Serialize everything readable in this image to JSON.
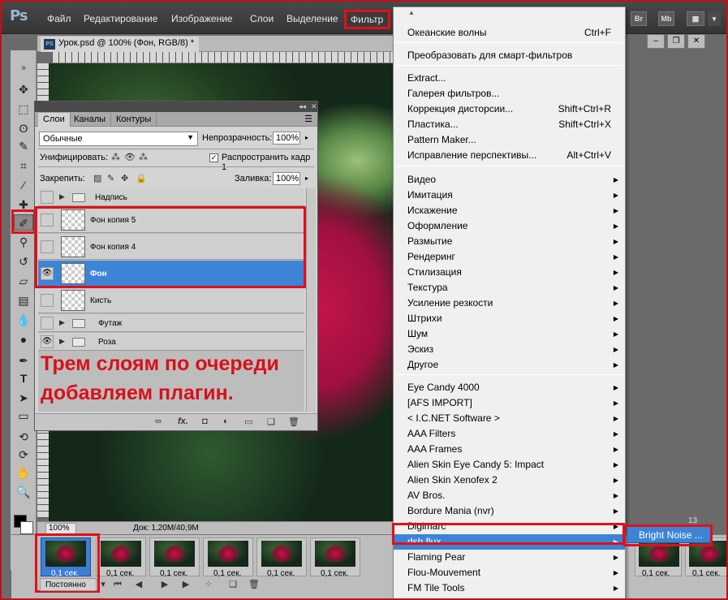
{
  "app": {
    "logo": "Ps",
    "menu": [
      "Файл",
      "Редактирование",
      "Изображение",
      "Слои",
      "Выделение",
      "Фильтр"
    ],
    "menubar_buttons": [
      "Br",
      "Mb"
    ]
  },
  "document": {
    "tab_title": "Урок.psd @ 100% (Фон, RGB/8) *",
    "ps_icon": "PS",
    "zoom": "100%",
    "doc_info": "Док: 1,20M/40,9M",
    "timeline_marker": "13"
  },
  "layers_panel": {
    "tabs": [
      "Слои",
      "Каналы",
      "Контуры"
    ],
    "blend_mode": "Обычные",
    "opacity_label": "Непрозрачность:",
    "opacity_value": "100%",
    "unify_label": "Унифицировать:",
    "propagate_label": "Распространить кадр 1",
    "lock_label": "Закрепить:",
    "fill_label": "Заливка:",
    "fill_value": "100%",
    "layers": [
      {
        "name": "Надпись",
        "type": "group",
        "visible": false
      },
      {
        "name": "Фон копия 5",
        "type": "layer",
        "visible": false
      },
      {
        "name": "Фон копия 4",
        "type": "layer",
        "visible": false
      },
      {
        "name": "Фон",
        "type": "layer",
        "visible": true,
        "selected": true
      },
      {
        "name": "Кисть",
        "type": "layer",
        "visible": false
      },
      {
        "name": "Футаж",
        "type": "group",
        "visible": false
      },
      {
        "name": "Роза",
        "type": "group",
        "visible": true
      }
    ],
    "bottom_icons": [
      "link-icon",
      "fx-icon",
      "mask-icon",
      "adjustment-icon",
      "new-group-icon",
      "new-layer-icon",
      "trash-icon"
    ],
    "fx_label": "fx."
  },
  "annotation": "Трем слоям по очереди добавляем плагин.",
  "filter_menu": {
    "groups": [
      [
        {
          "label": "Океанские волны",
          "shortcut": "Ctrl+F"
        }
      ],
      [
        {
          "label": "Преобразовать для смарт-фильтров"
        }
      ],
      [
        {
          "label": "Extract..."
        },
        {
          "label": "Галерея фильтров..."
        },
        {
          "label": "Коррекция дисторсии...",
          "shortcut": "Shift+Ctrl+R"
        },
        {
          "label": "Пластика...",
          "shortcut": "Shift+Ctrl+X"
        },
        {
          "label": "Pattern Maker..."
        },
        {
          "label": "Исправление перспективы...",
          "shortcut": "Alt+Ctrl+V"
        }
      ],
      [
        {
          "label": "Видео",
          "sub": true
        },
        {
          "label": "Имитация",
          "sub": true
        },
        {
          "label": "Искажение",
          "sub": true
        },
        {
          "label": "Оформление",
          "sub": true
        },
        {
          "label": "Размытие",
          "sub": true
        },
        {
          "label": "Рендеринг",
          "sub": true
        },
        {
          "label": "Стилизация",
          "sub": true
        },
        {
          "label": "Текстура",
          "sub": true
        },
        {
          "label": "Усиление резкости",
          "sub": true
        },
        {
          "label": "Штрихи",
          "sub": true
        },
        {
          "label": "Шум",
          "sub": true
        },
        {
          "label": "Эскиз",
          "sub": true
        },
        {
          "label": "Другое",
          "sub": true
        }
      ],
      [
        {
          "label": "Eye Candy 4000",
          "sub": true
        },
        {
          "label": "[AFS IMPORT]",
          "sub": true
        },
        {
          "label": "< I.C.NET Software >",
          "sub": true
        },
        {
          "label": "AAA Filters",
          "sub": true
        },
        {
          "label": "AAA Frames",
          "sub": true
        },
        {
          "label": "Alien Skin Eye Candy 5: Impact",
          "sub": true
        },
        {
          "label": "Alien Skin Xenofex 2",
          "sub": true
        },
        {
          "label": "AV Bros.",
          "sub": true
        },
        {
          "label": "Bordure Mania (nvr)",
          "sub": true
        },
        {
          "label": "Digimarc",
          "sub": true
        },
        {
          "label": "dsb flux",
          "sub": true,
          "highlighted": true
        },
        {
          "label": "Flaming Pear",
          "sub": true
        },
        {
          "label": "Flou-Mouvement",
          "sub": true
        },
        {
          "label": "FM Tile Tools",
          "sub": true
        }
      ]
    ],
    "submenu_item": "Bright Noise ..."
  },
  "animation": {
    "frame_time": "0,1 сек.",
    "loop": "Постоянно",
    "frames_count_visible": 12
  }
}
